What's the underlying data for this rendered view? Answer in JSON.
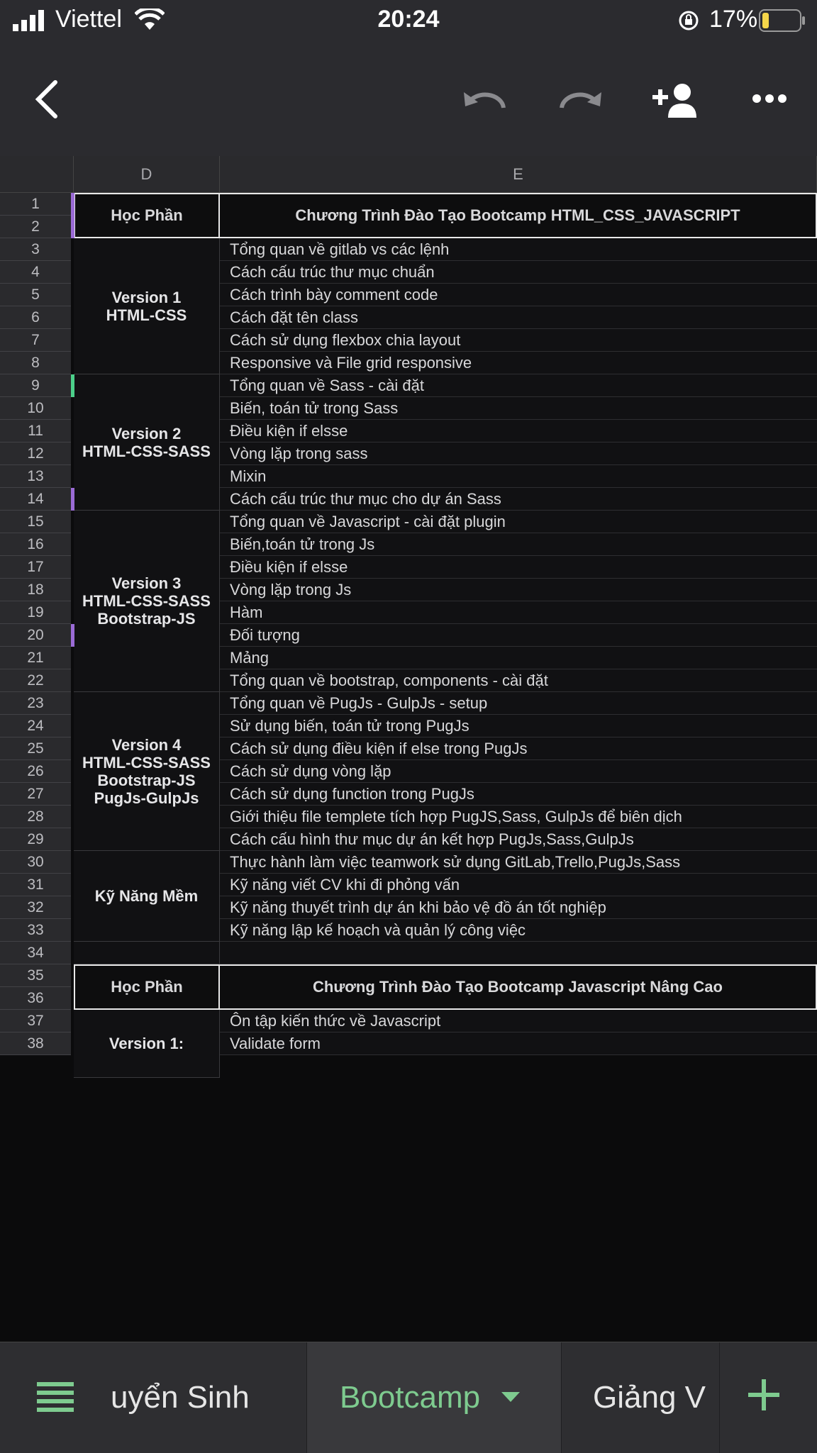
{
  "status_bar": {
    "carrier": "Viettel",
    "time": "20:24",
    "battery_percent": "17%"
  },
  "toolbar": {
    "back_icon": "chevron-left-icon",
    "undo_icon": "undo-icon",
    "redo_icon": "redo-icon",
    "share_icon": "add-person-icon",
    "more_icon": "more-horizontal-icon"
  },
  "columns": [
    "D",
    "E"
  ],
  "rows": [
    {
      "n": "1",
      "e": ""
    },
    {
      "n": "2",
      "e": ""
    },
    {
      "n": "3",
      "e": "Tổng quan về gitlab vs các lệnh"
    },
    {
      "n": "4",
      "e": "Cách cấu trúc thư mục chuẩn"
    },
    {
      "n": "5",
      "e": "Cách trình bày comment code"
    },
    {
      "n": "6",
      "e": "Cách đặt tên class"
    },
    {
      "n": "7",
      "e": "Cách sử dụng flexbox chia layout"
    },
    {
      "n": "8",
      "e": "Responsive và File grid responsive"
    },
    {
      "n": "9",
      "e": "Tổng quan về Sass - cài đặt"
    },
    {
      "n": "10",
      "e": "Biến, toán tử trong Sass"
    },
    {
      "n": "11",
      "e": "Điều kiện if elsse"
    },
    {
      "n": "12",
      "e": "Vòng lặp trong sass"
    },
    {
      "n": "13",
      "e": "Mixin"
    },
    {
      "n": "14",
      "e": "Cách cấu trúc thư mục cho dự án Sass"
    },
    {
      "n": "15",
      "e": "Tổng quan về Javascript - cài đặt plugin"
    },
    {
      "n": "16",
      "e": "Biến,toán tử trong Js"
    },
    {
      "n": "17",
      "e": "Điều kiện if elsse"
    },
    {
      "n": "18",
      "e": "Vòng lặp trong Js"
    },
    {
      "n": "19",
      "e": "Hàm"
    },
    {
      "n": "20",
      "e": "Đối tượng"
    },
    {
      "n": "21",
      "e": "Mảng"
    },
    {
      "n": "22",
      "e": "Tổng quan về bootstrap, components - cài đặt"
    },
    {
      "n": "23",
      "e": "Tổng quan về PugJs - GulpJs - setup"
    },
    {
      "n": "24",
      "e": "Sử dụng biến, toán tử trong PugJs"
    },
    {
      "n": "25",
      "e": "Cách sử dụng điều kiện if else trong PugJs"
    },
    {
      "n": "26",
      "e": "Cách sử dụng vòng lặp"
    },
    {
      "n": "27",
      "e": "Cách sử dụng function trong PugJs"
    },
    {
      "n": "28",
      "e": "Giới thiệu file templete tích hợp PugJS,Sass, GulpJs để biên dịch"
    },
    {
      "n": "29",
      "e": "Cách cấu hình thư mục dự án kết hợp PugJs,Sass,GulpJs"
    },
    {
      "n": "30",
      "e": "Thực hành làm việc teamwork sử dụng GitLab,Trello,PugJs,Sass"
    },
    {
      "n": "31",
      "e": "Kỹ năng viết CV khi đi phỏng vấn"
    },
    {
      "n": "32",
      "e": "Kỹ năng thuyết trình dự án khi bảo vệ đồ án tốt nghiệp"
    },
    {
      "n": "33",
      "e": "Kỹ năng lập kế hoạch và quản lý công việc"
    },
    {
      "n": "34",
      "e": ""
    },
    {
      "n": "35",
      "e": ""
    },
    {
      "n": "36",
      "e": ""
    },
    {
      "n": "37",
      "e": "Ôn tập kiến thức về Javascript"
    },
    {
      "n": "38",
      "e": "Validate form"
    }
  ],
  "header_blocks": [
    {
      "d": "Học Phần",
      "e": "Chương Trình Đào Tạo Bootcamp HTML_CSS_JAVASCRIPT"
    },
    {
      "d": "Học Phần",
      "e": "Chương Trình Đào Tạo Bootcamp Javascript Nâng Cao"
    }
  ],
  "groups": [
    {
      "label": "Version 1\nHTML-CSS"
    },
    {
      "label": "Version 2\nHTML-CSS-SASS"
    },
    {
      "label": "Version 3\nHTML-CSS-SASS\nBootstrap-JS"
    },
    {
      "label": "Version 4\nHTML-CSS-SASS\nBootstrap-JS\nPugJs-GulpJs"
    },
    {
      "label": "Kỹ Năng Mềm"
    },
    {
      "label": "Version 1:"
    }
  ],
  "tabs": {
    "menu_icon": "sheet-list-icon",
    "items": [
      "uyển Sinh",
      "Bootcamp",
      "Giảng V"
    ],
    "active": "Bootcamp",
    "dropdown_icon": "caret-down-icon",
    "add_icon": "plus-icon",
    "accent_color": "#7ecb8f"
  }
}
